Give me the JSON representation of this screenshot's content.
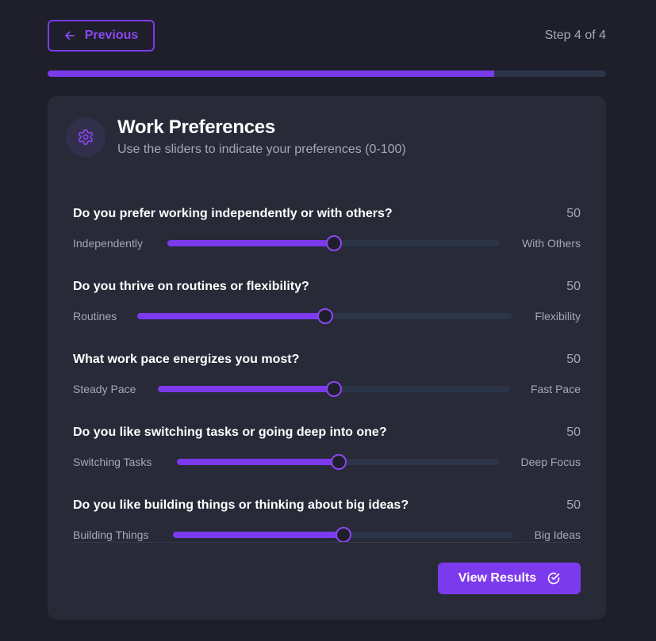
{
  "nav": {
    "previous_label": "Previous",
    "step_text": "Step 4 of 4",
    "progress_fraction": 0.8
  },
  "colors": {
    "accent": "#7c3aed",
    "background": "#1e1f2b",
    "card": "#282a38",
    "track": "#2c3448"
  },
  "card": {
    "icon": "gear-icon",
    "title": "Work Preferences",
    "subtitle": "Use the sliders to indicate your preferences (0-100)"
  },
  "questions": [
    {
      "question": "Do you prefer working independently or with others?",
      "value": "50",
      "left_label": "Independently",
      "right_label": "With Others",
      "level": 0.5
    },
    {
      "question": "Do you thrive on routines or flexibility?",
      "value": "50",
      "left_label": "Routines",
      "right_label": "Flexibility",
      "level": 0.5
    },
    {
      "question": "What work pace energizes you most?",
      "value": "50",
      "left_label": "Steady Pace",
      "right_label": "Fast Pace",
      "level": 0.5
    },
    {
      "question": "Do you like switching tasks or going deep into one?",
      "value": "50",
      "left_label": "Switching Tasks",
      "right_label": "Deep Focus",
      "level": 0.5
    },
    {
      "question": "Do you like building things or thinking about big ideas?",
      "value": "50",
      "left_label": "Building Things",
      "right_label": "Big Ideas",
      "level": 0.5
    }
  ],
  "actions": {
    "results_label": "View Results",
    "results_icon": "check-circle-icon"
  }
}
